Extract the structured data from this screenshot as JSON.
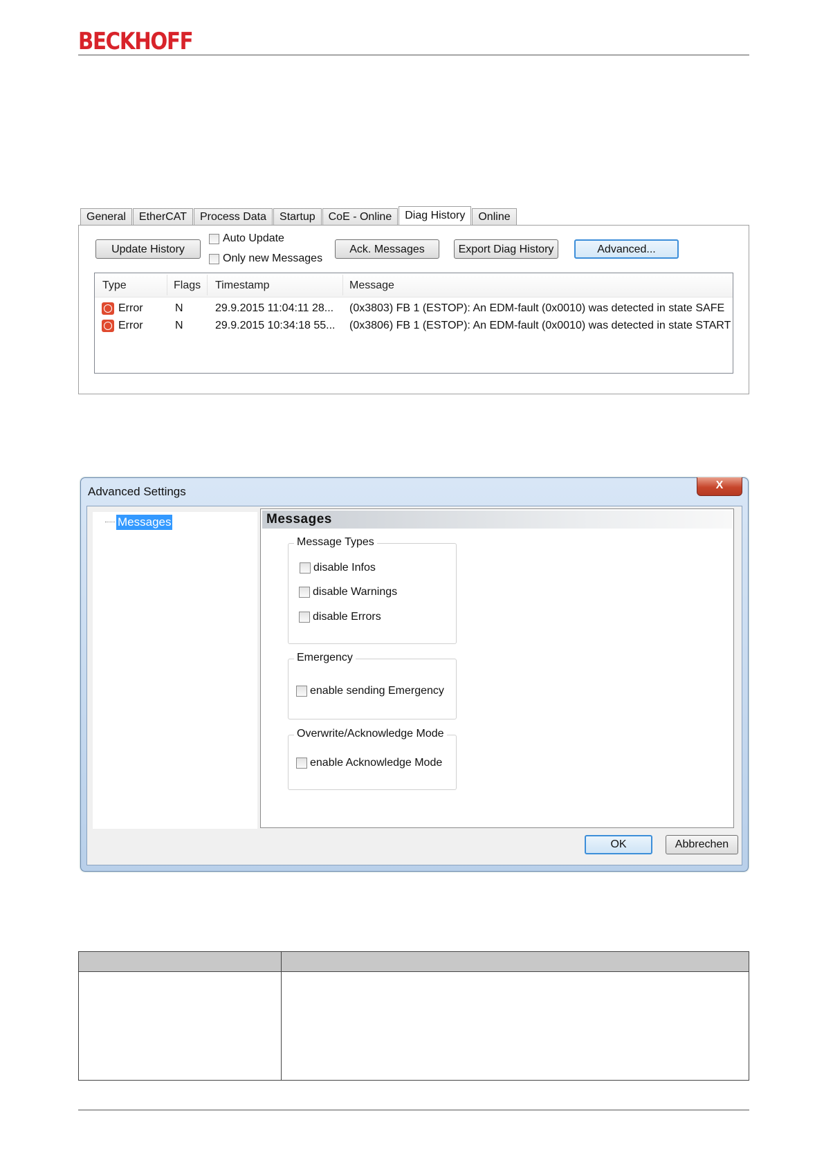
{
  "header": {
    "brand": "BECKHOFF"
  },
  "diag_panel": {
    "tabs": [
      {
        "label": "General"
      },
      {
        "label": "EtherCAT"
      },
      {
        "label": "Process Data"
      },
      {
        "label": "Startup"
      },
      {
        "label": "CoE - Online"
      },
      {
        "label": "Diag History",
        "active": true
      },
      {
        "label": "Online"
      }
    ],
    "buttons": {
      "update_history": "Update History",
      "ack_messages": "Ack. Messages",
      "export": "Export Diag History",
      "advanced": "Advanced..."
    },
    "checkboxes": {
      "auto_update": "Auto Update",
      "only_new": "Only new Messages"
    },
    "columns": [
      "Type",
      "Flags",
      "Timestamp",
      "Message"
    ],
    "rows": [
      {
        "type": "Error",
        "flags": "N",
        "timestamp": "29.9.2015 11:04:11 28...",
        "message": "(0x3803) FB 1 (ESTOP): An EDM-fault (0x0010) was detected in state SAFE"
      },
      {
        "type": "Error",
        "flags": "N",
        "timestamp": "29.9.2015 10:34:18 55...",
        "message": "(0x3806) FB 1 (ESTOP): An EDM-fault (0x0010) was detected in state START"
      }
    ],
    "error_icon": "error-icon",
    "error_color": "#e04a2f"
  },
  "advanced_dialog": {
    "title": "Advanced Settings",
    "close_symbol": "X",
    "tree_item": "Messages",
    "content_title": "Messages",
    "groups": {
      "message_types": {
        "label": "Message Types",
        "options": [
          "disable Infos",
          "disable Warnings",
          "disable Errors"
        ]
      },
      "emergency": {
        "label": "Emergency",
        "options": [
          "enable sending Emergency"
        ]
      },
      "ack_mode": {
        "label": "Overwrite/Acknowledge Mode",
        "options": [
          "enable Acknowledge Mode"
        ]
      }
    },
    "ok": "OK",
    "cancel": "Abbrechen"
  }
}
